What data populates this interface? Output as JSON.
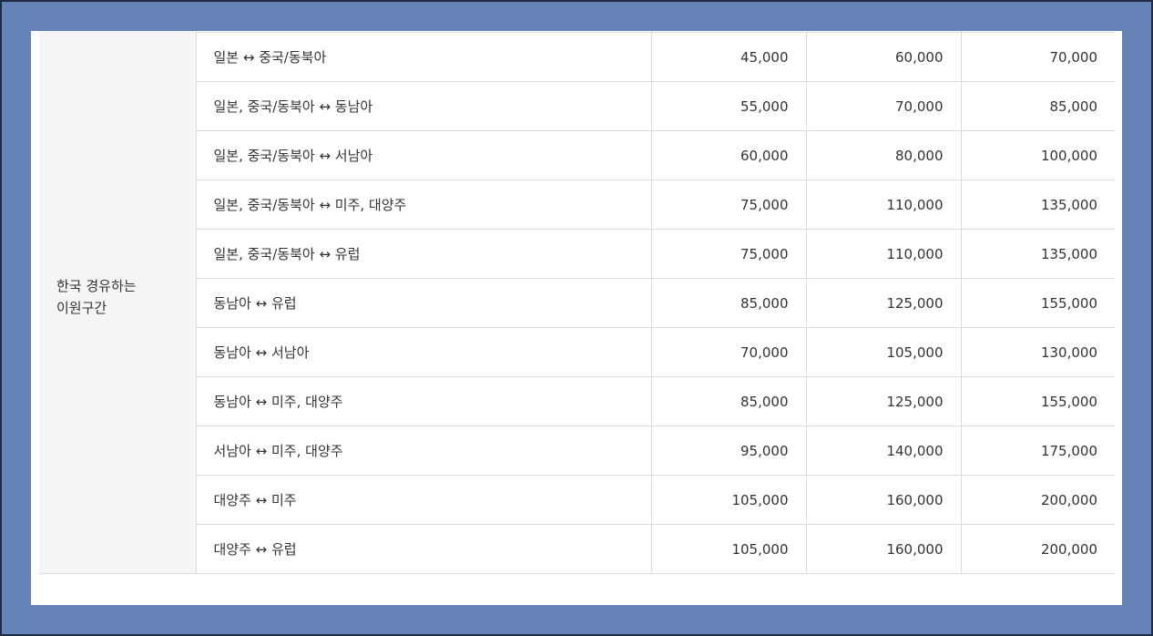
{
  "table": {
    "group_label": "한국 경유하는\n이원구간",
    "rows": [
      {
        "route": "일본 ↔ 중국/동북아",
        "values": [
          "45,000",
          "60,000",
          "70,000"
        ]
      },
      {
        "route": "일본, 중국/동북아 ↔ 동남아",
        "values": [
          "55,000",
          "70,000",
          "85,000"
        ]
      },
      {
        "route": "일본, 중국/동북아 ↔ 서남아",
        "values": [
          "60,000",
          "80,000",
          "100,000"
        ]
      },
      {
        "route": "일본, 중국/동북아 ↔ 미주, 대양주",
        "values": [
          "75,000",
          "110,000",
          "135,000"
        ]
      },
      {
        "route": "일본, 중국/동북아 ↔ 유럽",
        "values": [
          "75,000",
          "110,000",
          "135,000"
        ]
      },
      {
        "route": "동남아 ↔ 유럽",
        "values": [
          "85,000",
          "125,000",
          "155,000"
        ]
      },
      {
        "route": "동남아 ↔ 서남아",
        "values": [
          "70,000",
          "105,000",
          "130,000"
        ]
      },
      {
        "route": "동남아 ↔ 미주, 대양주",
        "values": [
          "85,000",
          "125,000",
          "155,000"
        ]
      },
      {
        "route": "서남아 ↔ 미주, 대양주",
        "values": [
          "95,000",
          "140,000",
          "175,000"
        ]
      },
      {
        "route": "대양주 ↔ 미주",
        "values": [
          "105,000",
          "160,000",
          "200,000"
        ]
      },
      {
        "route": "대양주 ↔ 유럽",
        "values": [
          "105,000",
          "160,000",
          "200,000"
        ]
      }
    ]
  }
}
